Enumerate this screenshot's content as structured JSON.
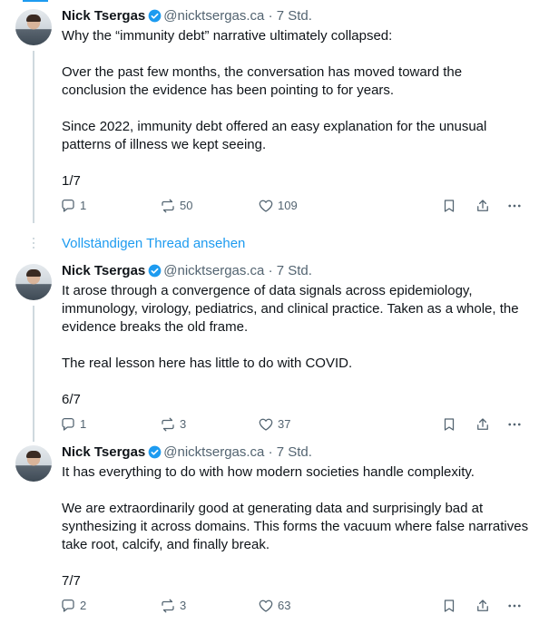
{
  "author": {
    "name": "Nick Tsergas",
    "handle": "@nicktsergas.ca",
    "separator": "·"
  },
  "show_thread_label": "Vollständigen Thread ansehen",
  "posts": [
    {
      "time": "7 Std.",
      "paragraphs": [
        "Why the “immunity debt” narrative ultimately collapsed:",
        "Over the past few months, the conversation has moved toward the conclusion the evidence has been pointing to for years.",
        "Since 2022, immunity debt offered an easy explanation for the unusual patterns of illness we kept seeing.",
        "1/7"
      ],
      "replies": "1",
      "reposts": "50",
      "likes": "109"
    },
    {
      "time": "7 Std.",
      "paragraphs": [
        "It arose through a convergence of data signals across epidemiology, immunology, virology, pediatrics, and clinical practice. Taken as a whole, the evidence breaks the old frame.",
        "The real lesson here has little to do with COVID.",
        "6/7"
      ],
      "replies": "1",
      "reposts": "3",
      "likes": "37"
    },
    {
      "time": "7 Std.",
      "paragraphs": [
        "It has everything to do with how modern societies handle complexity.",
        "We are extraordinarily good at generating data and surprisingly bad at synthesizing it across domains. This forms the vacuum where false narratives take root, calcify, and finally break.",
        "7/7"
      ],
      "replies": "2",
      "reposts": "3",
      "likes": "63"
    }
  ],
  "icons": [
    "reply-icon",
    "repost-icon",
    "like-icon",
    "bookmark-icon",
    "share-icon",
    "more-icon",
    "verified-icon"
  ],
  "colors": {
    "accent": "#1d9bf0",
    "text": "#0f1419",
    "muted": "#536471",
    "line": "#cfd9de"
  }
}
